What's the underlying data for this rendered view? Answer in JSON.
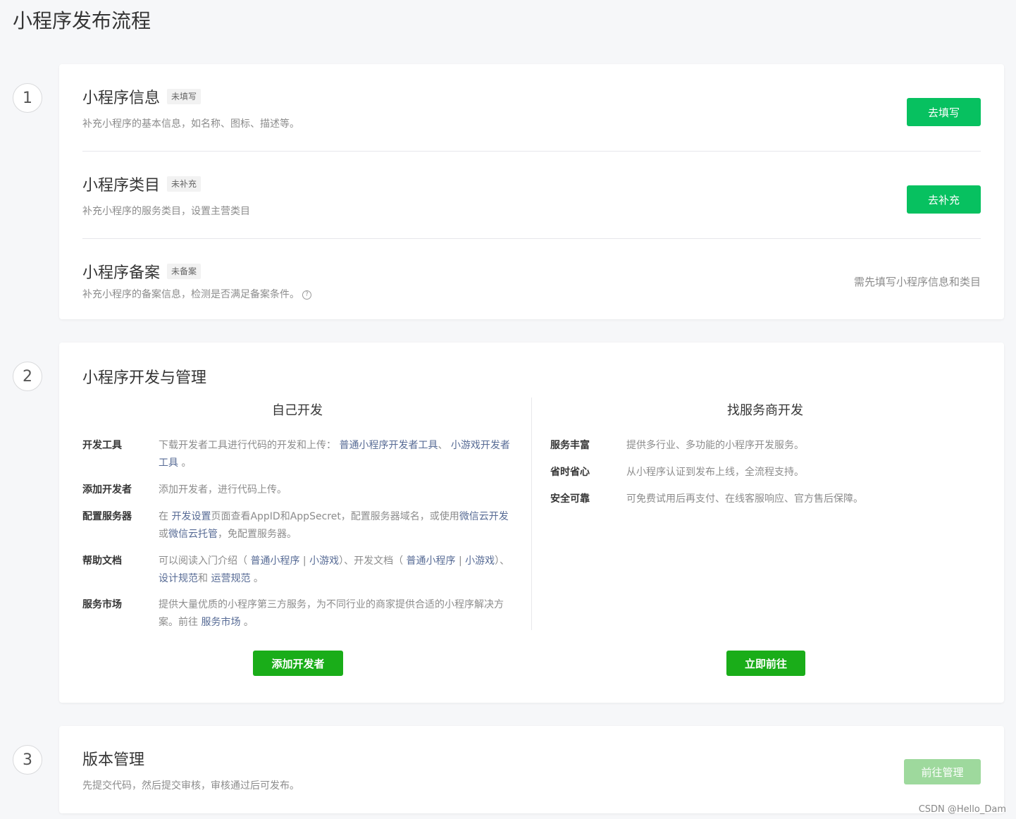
{
  "page_title": "小程序发布流程",
  "steps": [
    "1",
    "2",
    "3"
  ],
  "step1": {
    "info": {
      "title": "小程序信息",
      "badge": "未填写",
      "desc": "补充小程序的基本信息，如名称、图标、描述等。",
      "button": "去填写"
    },
    "category": {
      "title": "小程序类目",
      "badge": "未补充",
      "desc": "补充小程序的服务类目，设置主营类目",
      "button": "去补充"
    },
    "filing": {
      "title": "小程序备案",
      "badge": "未备案",
      "desc": "补充小程序的备案信息，检测是否满足备案条件。",
      "help_icon": "?",
      "hint": "需先填写小程序信息和类目"
    }
  },
  "step2": {
    "title": "小程序开发与管理",
    "self": {
      "heading": "自己开发",
      "items": [
        {
          "label": "开发工具",
          "parts": [
            "下载开发者工具进行代码的开发和上传： ",
            "普通小程序开发者工具",
            "、 ",
            "小游戏开发者工具",
            " 。"
          ]
        },
        {
          "label": "添加开发者",
          "parts": [
            "添加开发者，进行代码上传。"
          ]
        },
        {
          "label": "配置服务器",
          "parts": [
            "在 ",
            "开发设置",
            "页面查看AppID和AppSecret，配置服务器域名，或使用",
            "微信云开发",
            "或",
            "微信云托管",
            "，免配置服务器。"
          ]
        },
        {
          "label": "帮助文档",
          "parts": [
            "可以阅读入门介绍（ ",
            "普通小程序",
            " | ",
            "小游戏",
            "）、开发文档（ ",
            "普通小程序",
            " | ",
            "小游戏",
            "）、 ",
            "设计规范",
            "和 ",
            "运营规范",
            " 。"
          ]
        },
        {
          "label": "服务市场",
          "parts": [
            "提供大量优质的小程序第三方服务，为不同行业的商家提供合适的小程序解决方案。前往 ",
            "服务市场",
            " 。"
          ]
        }
      ],
      "button": "添加开发者"
    },
    "vendor": {
      "heading": "找服务商开发",
      "items": [
        {
          "label": "服务丰富",
          "text": "提供多行业、多功能的小程序开发服务。"
        },
        {
          "label": "省时省心",
          "text": "从小程序认证到发布上线，全流程支持。"
        },
        {
          "label": "安全可靠",
          "text": "可免费试用后再支付、在线客服响应、官方售后保障。"
        }
      ],
      "button": "立即前往"
    }
  },
  "step3": {
    "title": "版本管理",
    "desc": "先提交代码，然后提交审核，审核通过后可发布。",
    "button": "前往管理"
  },
  "watermark": "CSDN @Hello_Dam",
  "colors": {
    "primary": "#07c160",
    "dark_green": "#1aad19",
    "disabled": "#9ed99d",
    "link": "#576b95"
  }
}
